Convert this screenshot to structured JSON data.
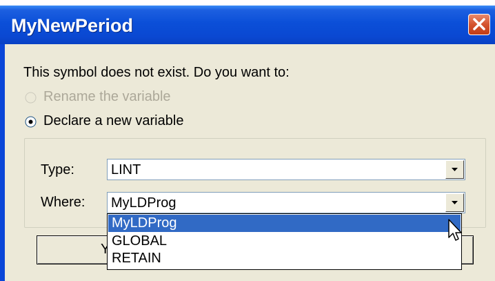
{
  "dialog": {
    "title": "MyNewPeriod",
    "message": "This symbol does not exist. Do you want to:",
    "options": [
      {
        "label": "Rename the variable",
        "enabled": false,
        "selected": false
      },
      {
        "label": "Declare a new variable",
        "enabled": true,
        "selected": true
      }
    ],
    "fields": {
      "type_label": "Type:",
      "type_value": "LINT",
      "where_label": "Where:",
      "where_value": "MyLDProg"
    },
    "where_dropdown": {
      "items": [
        "MyLDProg",
        "GLOBAL",
        "RETAIN"
      ],
      "highlighted": "MyLDProg"
    },
    "buttons": {
      "yes_visible_label": "Ye"
    },
    "colors": {
      "title_bar": "#0a4fd8",
      "client_bg": "#ece9d8",
      "selection": "#316ac5",
      "close_button": "#d4532e"
    }
  }
}
